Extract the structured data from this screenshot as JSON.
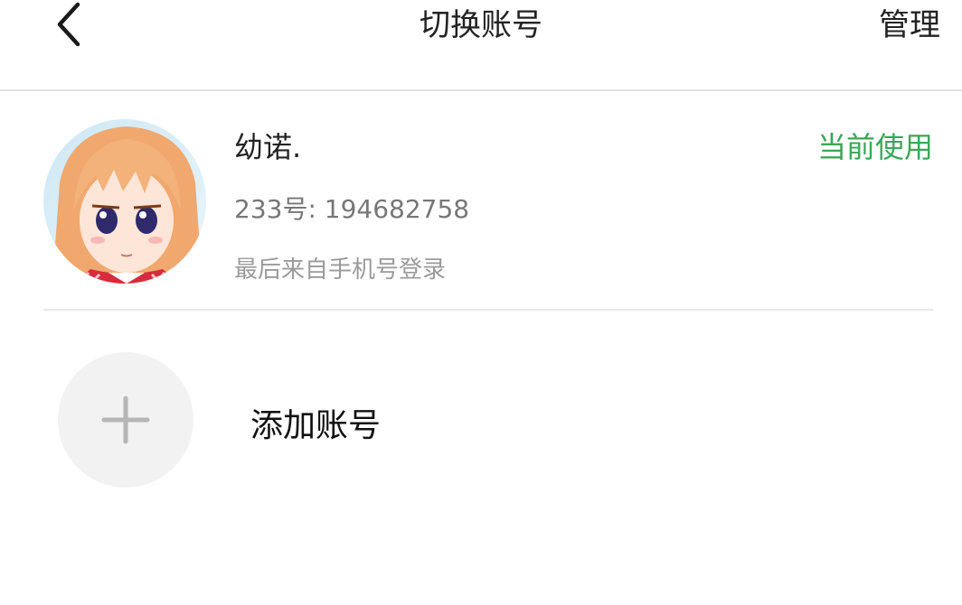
{
  "header": {
    "back_icon": "chevron-left-icon",
    "title": "切换账号",
    "manage_label": "管理"
  },
  "account": {
    "name": "幼诺.",
    "status": "当前使用",
    "id_text": "233号: 194682758",
    "login_source": "最后来自手机号登录",
    "status_color": "#3aa757"
  },
  "add_account": {
    "icon": "plus-icon",
    "label": "添加账号"
  }
}
